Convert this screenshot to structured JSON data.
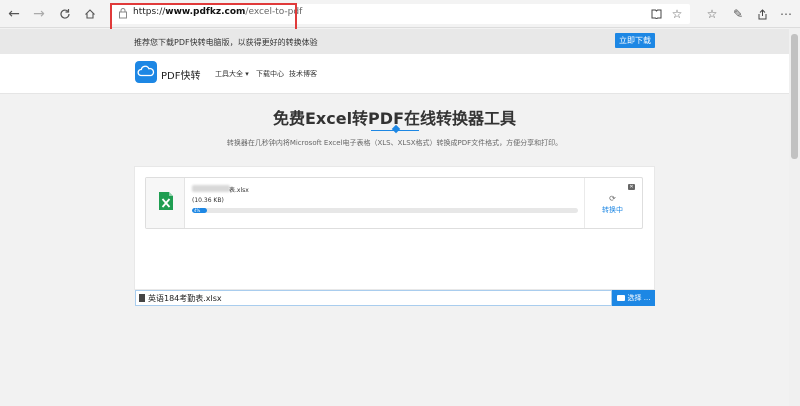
{
  "browser": {
    "url_scheme": "https://",
    "url_host": "www.pdfkz.com",
    "url_path": "/excel-to-pdf"
  },
  "promo": {
    "text": "推荐您下载PDF快转电脑版，以获得更好的转换体验",
    "button_label": "立即下载"
  },
  "header": {
    "logo_text": "PDF快转",
    "nav": [
      {
        "label": "工具大全 ▾"
      },
      {
        "label": "下载中心"
      },
      {
        "label": "技术博客"
      }
    ]
  },
  "main": {
    "title": "免费Excel转PDF在线转换器工具",
    "subtitle": "转换器在几秒钟内将Microsoft Excel电子表格（XLS、XLSX格式）转换成PDF文件格式，方便分享和打印。"
  },
  "upload": {
    "file_ext": "表.xlsx",
    "file_size": "(10.36 KB)",
    "progress": 4,
    "progress_label": "4%",
    "status": "转换中",
    "input_value": "英语184考勤表.xlsx",
    "browse_label": "选择 ..."
  },
  "colors": {
    "accent": "#1d87e4",
    "highlight": "#e03a3a",
    "excel": "#1f9e52"
  },
  "icons": {
    "back": "arrow-left-icon",
    "forward": "arrow-right-icon",
    "refresh": "refresh-icon",
    "home": "home-icon",
    "lock": "lock-icon",
    "reading_view": "book-icon",
    "favorite": "star-icon",
    "favorites_list": "stars-icon",
    "notes": "pen-icon",
    "share": "share-icon",
    "more": "ellipsis-icon"
  }
}
